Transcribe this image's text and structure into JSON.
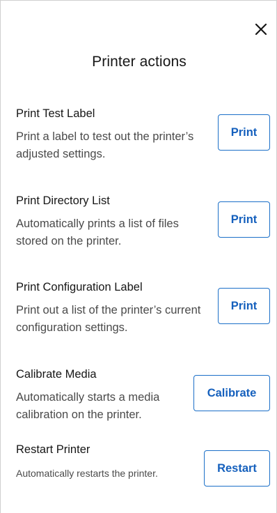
{
  "dialog": {
    "title": "Printer actions",
    "close_icon": "close-icon"
  },
  "actions": [
    {
      "title": "Print Test Label",
      "description": "Print a label to test out the printer’s adjusted settings.",
      "button": "Print"
    },
    {
      "title": "Print Directory List",
      "description": "Automatically prints a list of files stored on the printer.",
      "button": "Print"
    },
    {
      "title": "Print Configuration Label",
      "description": "Print out a list of the printer’s current configuration settings.",
      "button": "Print"
    },
    {
      "title": "Calibrate Media",
      "description": "Automatically starts a media calibration on the printer.",
      "button": "Calibrate"
    },
    {
      "title": "Restart Printer",
      "description": "Automatically restarts the printer.",
      "button": "Restart"
    }
  ],
  "colors": {
    "accent": "#1560bd",
    "border": "#cfcfcf",
    "text": "#161616",
    "muted_text": "#4a4a4a"
  }
}
